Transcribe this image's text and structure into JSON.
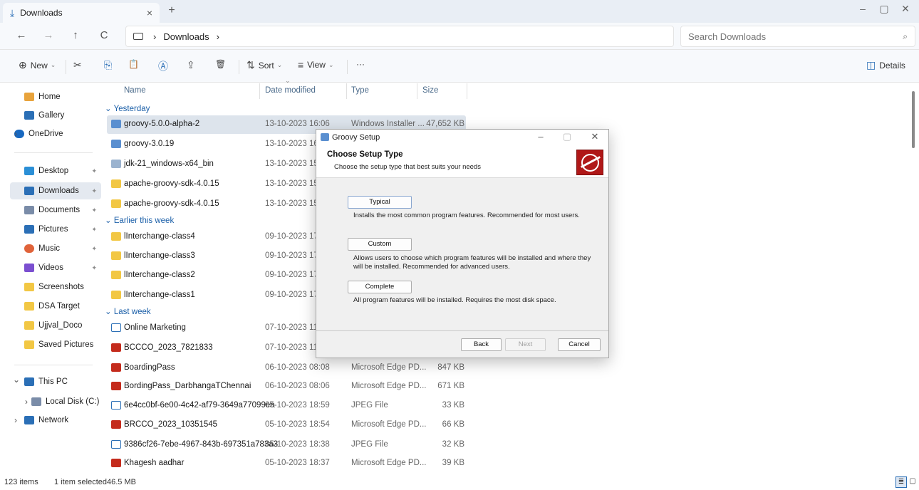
{
  "window": {
    "tab_label": "Downloads",
    "tab_close": "×",
    "new_tab": "+",
    "controls": [
      "–",
      "▢",
      "✕"
    ]
  },
  "address": {
    "back": "←",
    "forward": "→",
    "up": "↑",
    "refresh": "C",
    "crumb_sep": "›",
    "crumb": "Downloads",
    "crumb_end": "›",
    "search_placeholder": "Search Downloads",
    "search_icon": "⌕"
  },
  "commands": {
    "new": "New",
    "new_icon": "⊕",
    "cut_icon": "✂",
    "copy_icon": "⎘",
    "paste_icon": "📋",
    "rename_icon": "Ⓐ",
    "share_icon": "⇪",
    "delete_icon": "🗑",
    "sort": "Sort",
    "sort_icon": "⇅",
    "view": "View",
    "view_icon": "≡",
    "more": "···",
    "details": "Details",
    "details_icon": "◫",
    "chevron": "⌄"
  },
  "sidebar": {
    "items": [
      {
        "label": "Home",
        "icon": "home-icon",
        "color": "#e8a33c"
      },
      {
        "label": "Gallery",
        "icon": "gallery-icon",
        "color": "#2b6fb6"
      },
      {
        "label": "OneDrive",
        "icon": "cloud-icon",
        "color": "#1868c0"
      },
      {
        "label": "Desktop",
        "icon": "desktop-icon",
        "color": "#2b8fd6"
      },
      {
        "label": "Downloads",
        "icon": "download-icon",
        "color": "#2b6fb6"
      },
      {
        "label": "Documents",
        "icon": "documents-icon",
        "color": "#7a8ca8"
      },
      {
        "label": "Pictures",
        "icon": "pictures-icon",
        "color": "#2b6fb6"
      },
      {
        "label": "Music",
        "icon": "music-icon",
        "color": "#e0633a"
      },
      {
        "label": "Videos",
        "icon": "videos-icon",
        "color": "#7b4fd0"
      },
      {
        "label": "Screenshots",
        "icon": "folder-icon",
        "color": "#f2c744"
      },
      {
        "label": "DSA Target",
        "icon": "folder-icon",
        "color": "#f2c744"
      },
      {
        "label": "Ujjval_Doco",
        "icon": "folder-icon",
        "color": "#f2c744"
      },
      {
        "label": "Saved Pictures",
        "icon": "folder-icon",
        "color": "#f2c744"
      },
      {
        "label": "This PC",
        "icon": "pc-icon",
        "color": "#2b6fb6"
      },
      {
        "label": "Local Disk (C:)",
        "icon": "disk-icon",
        "color": "#7a8ca8"
      },
      {
        "label": "Network",
        "icon": "network-icon",
        "color": "#2b6fb6"
      }
    ],
    "expand_closed": "›",
    "expand_open": "⌄",
    "pin": "✦"
  },
  "columns": {
    "name": "Name",
    "date": "Date modified",
    "type": "Type",
    "size": "Size",
    "sort_indicator": "⌄"
  },
  "groups": [
    {
      "label": "Yesterday"
    },
    {
      "label": "Earlier this week"
    },
    {
      "label": "Last week"
    }
  ],
  "group_chevron": "⌄",
  "files": [
    {
      "name": "groovy-5.0.0-alpha-2",
      "date": "13-10-2023 16:06",
      "type": "Windows Installer ...",
      "size": "47,652 KB",
      "icon": "msi"
    },
    {
      "name": "groovy-3.0.19",
      "date": "13-10-2023 16:0",
      "type": "",
      "size": "",
      "icon": "msi"
    },
    {
      "name": "jdk-21_windows-x64_bin",
      "date": "13-10-2023 15:5",
      "type": "",
      "size": "",
      "icon": "jdk"
    },
    {
      "name": "apache-groovy-sdk-4.0.15",
      "date": "13-10-2023 15:2",
      "type": "",
      "size": "",
      "icon": "folder"
    },
    {
      "name": "apache-groovy-sdk-4.0.15",
      "date": "13-10-2023 15:3",
      "type": "",
      "size": "",
      "icon": "folder"
    },
    {
      "name": "lInterchange-class4",
      "date": "09-10-2023 17:4",
      "type": "",
      "size": "",
      "icon": "folder"
    },
    {
      "name": "lInterchange-class3",
      "date": "09-10-2023 17:4",
      "type": "",
      "size": "",
      "icon": "folder"
    },
    {
      "name": "lInterchange-class2",
      "date": "09-10-2023 17:4",
      "type": "",
      "size": "",
      "icon": "folder"
    },
    {
      "name": "lInterchange-class1",
      "date": "09-10-2023 17:4",
      "type": "",
      "size": "",
      "icon": "folder"
    },
    {
      "name": "Online Marketing",
      "date": "07-10-2023 11:4",
      "type": "",
      "size": "",
      "icon": "doc"
    },
    {
      "name": "BCCCO_2023_7821833",
      "date": "07-10-2023 11:1",
      "type": "",
      "size": "",
      "icon": "pdf"
    },
    {
      "name": "BoardingPass",
      "date": "06-10-2023 08:08",
      "type": "Microsoft Edge PD...",
      "size": "847 KB",
      "icon": "pdf"
    },
    {
      "name": "BordingPass_DarbhangaTChennai",
      "date": "06-10-2023 08:06",
      "type": "Microsoft Edge PD...",
      "size": "671 KB",
      "icon": "pdf"
    },
    {
      "name": "6e4cc0bf-6e00-4c42-af79-3649a77099ea",
      "date": "05-10-2023 18:59",
      "type": "JPEG File",
      "size": "33 KB",
      "icon": "jpg"
    },
    {
      "name": "BRCCO_2023_10351545",
      "date": "05-10-2023 18:54",
      "type": "Microsoft Edge PD...",
      "size": "66 KB",
      "icon": "pdf"
    },
    {
      "name": "9386cf26-7ebe-4967-843b-697351a783a3",
      "date": "05-10-2023 18:38",
      "type": "JPEG File",
      "size": "32 KB",
      "icon": "jpg"
    },
    {
      "name": "Khagesh aadhar",
      "date": "05-10-2023 18:37",
      "type": "Microsoft Edge PD...",
      "size": "39 KB",
      "icon": "pdf"
    }
  ],
  "status": {
    "count": "123 items",
    "selected": "1 item selected",
    "size": "46.5 MB",
    "list_view": "≣",
    "tiles_view": "▢"
  },
  "dialog": {
    "title": "Groovy Setup",
    "controls": [
      "–",
      "▢",
      "✕"
    ],
    "heading": "Choose Setup Type",
    "subheading": "Choose the setup type that best suits your needs",
    "options": [
      {
        "label": "Typical",
        "desc": "Installs the most common program features. Recommended for most users."
      },
      {
        "label": "Custom",
        "desc": "Allows users to choose which program features will be installed and where they will be installed. Recommended for advanced users."
      },
      {
        "label": "Complete",
        "desc": "All program features will be installed. Requires the most disk space."
      }
    ],
    "back": "Back",
    "next": "Next",
    "cancel": "Cancel"
  }
}
